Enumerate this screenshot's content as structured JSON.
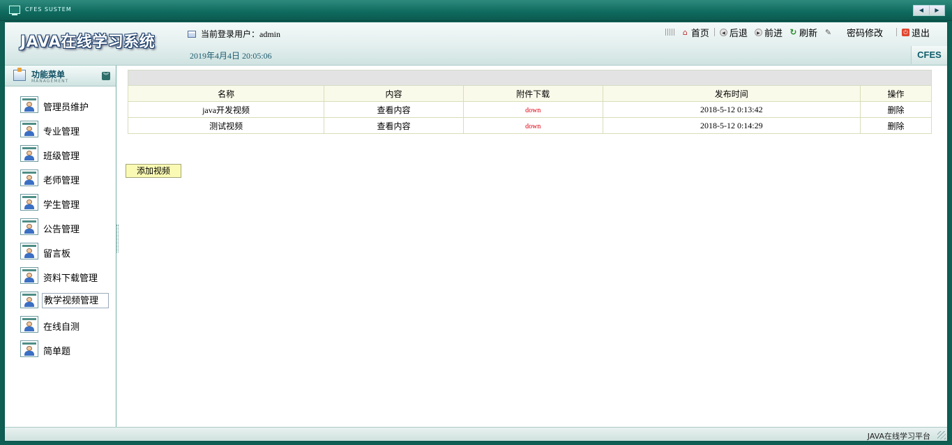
{
  "window": {
    "title": "CFES SUSTEM",
    "nav_prev": "◀",
    "nav_next": "▶"
  },
  "header": {
    "logo": "JAVA在线学习系统",
    "user_label": "当前登录用户：",
    "username": "admin",
    "datetime": "2019年4月4日  20:05:06",
    "brand_tag": "CFES",
    "toolbar": [
      {
        "label": "首页",
        "icon": "home-icon"
      },
      {
        "label": "后退",
        "icon": "back-icon"
      },
      {
        "label": "前进",
        "icon": "forward-icon"
      },
      {
        "label": "刷新",
        "icon": "refresh-icon"
      },
      {
        "label": "密码修改",
        "icon": "password-icon"
      },
      {
        "label": "退出",
        "icon": "exit-icon"
      }
    ]
  },
  "sidebar": {
    "title": "功能菜单",
    "subtitle": "MANAGEMENT",
    "toggle": "︾",
    "items": [
      {
        "label": "管理员维护"
      },
      {
        "label": "专业管理"
      },
      {
        "label": "班级管理"
      },
      {
        "label": "老师管理"
      },
      {
        "label": "学生管理"
      },
      {
        "label": "公告管理"
      },
      {
        "label": "留言板"
      },
      {
        "label": "资料下载管理"
      },
      {
        "label": "教学视频管理",
        "active": true
      },
      {
        "label": "在线自测"
      },
      {
        "label": "简单题"
      }
    ]
  },
  "table": {
    "columns": [
      "名称",
      "内容",
      "附件下载",
      "发布时间",
      "操作"
    ],
    "rows": [
      {
        "name": "java开发视频",
        "content": "查看内容",
        "attachment": "down",
        "time": "2018-5-12 0:13:42",
        "action": "删除"
      },
      {
        "name": "测试视频",
        "content": "查看内容",
        "attachment": "down",
        "time": "2018-5-12 0:14:29",
        "action": "删除"
      }
    ]
  },
  "add_button": "添加视频",
  "footer": "JAVA在线学习平台",
  "colors": {
    "frame": "#0f5f55",
    "header_bg": "#e3efee",
    "table_header_bg": "#fafaea",
    "down_link": "#dd0011",
    "add_button_bg": "#fafab4"
  }
}
